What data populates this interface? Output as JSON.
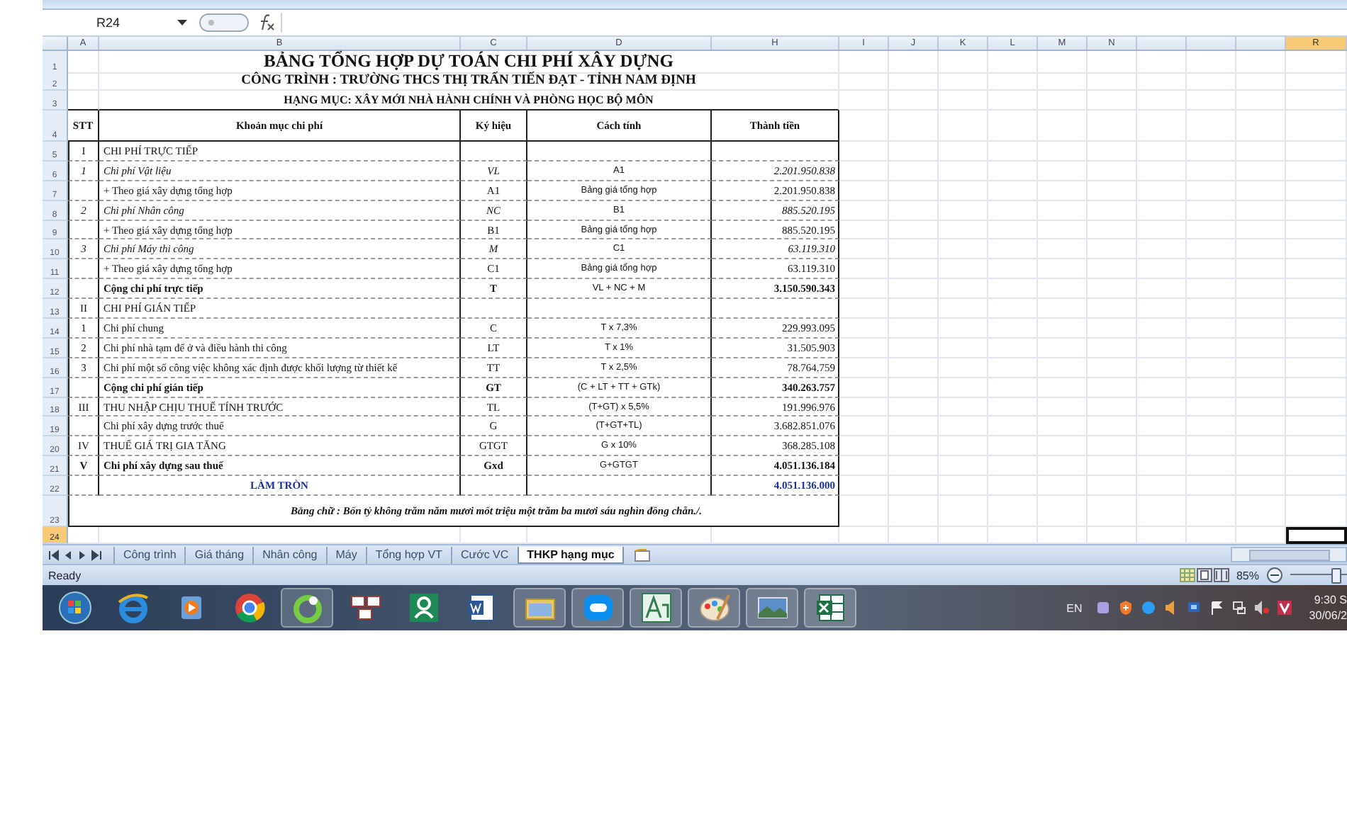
{
  "name_box": "R24",
  "column_headers": [
    {
      "label": "A",
      "selected": false
    },
    {
      "label": "B",
      "selected": false
    },
    {
      "label": "C",
      "selected": false
    },
    {
      "label": "D",
      "selected": false
    },
    {
      "label": "H",
      "selected": false
    },
    {
      "label": "I",
      "selected": false
    },
    {
      "label": "J",
      "selected": false
    },
    {
      "label": "K",
      "selected": false
    },
    {
      "label": "L",
      "selected": false
    },
    {
      "label": "M",
      "selected": false
    },
    {
      "label": "N",
      "selected": false
    },
    {
      "label": "R",
      "selected": true
    }
  ],
  "row_headers": [
    {
      "label": "1",
      "selected": false
    },
    {
      "label": "2",
      "selected": false
    },
    {
      "label": "3",
      "selected": false
    },
    {
      "label": "4",
      "selected": false
    },
    {
      "label": "5",
      "selected": false
    },
    {
      "label": "6",
      "selected": false
    },
    {
      "label": "7",
      "selected": false
    },
    {
      "label": "8",
      "selected": false
    },
    {
      "label": "9",
      "selected": false
    },
    {
      "label": "10",
      "selected": false
    },
    {
      "label": "11",
      "selected": false
    },
    {
      "label": "12",
      "selected": false
    },
    {
      "label": "13",
      "selected": false
    },
    {
      "label": "14",
      "selected": false
    },
    {
      "label": "15",
      "selected": false
    },
    {
      "label": "16",
      "selected": false
    },
    {
      "label": "17",
      "selected": false
    },
    {
      "label": "18",
      "selected": false
    },
    {
      "label": "19",
      "selected": false
    },
    {
      "label": "20",
      "selected": false
    },
    {
      "label": "21",
      "selected": false
    },
    {
      "label": "22",
      "selected": false
    },
    {
      "label": "23",
      "selected": false
    },
    {
      "label": "24",
      "selected": true
    }
  ],
  "titles": [
    "BẢNG TỔNG HỢP DỰ TOÁN CHI PHÍ XÂY DỰNG",
    "CÔNG TRÌNH : TRƯỜNG THCS THỊ TRẤN TIẾN ĐẠT - TỈNH NAM ĐỊNH",
    "HẠNG MỤC: XÂY MỚI NHÀ HÀNH CHÍNH VÀ PHÒNG HỌC BỘ MÔN"
  ],
  "table": {
    "columns": [
      "STT",
      "Khoản mục chi phí",
      "Ký hiệu",
      "Cách tính",
      "Thành tiền"
    ],
    "rows": [
      {
        "kind": "group",
        "stt": "I",
        "item": "CHI PHÍ TRỰC TIẾP"
      },
      {
        "kind": "italic",
        "stt": "1",
        "item": "Chi phí Vật liệu",
        "symbol": "VL",
        "formula": "A1",
        "amount": "2.201.950.838"
      },
      {
        "kind": "plain",
        "item": "+ Theo giá xây dựng tổng hợp",
        "symbol": "A1",
        "formula": "Bảng giá tổng hợp",
        "amount": "2.201.950.838"
      },
      {
        "kind": "italic",
        "stt": "2",
        "item": "Chi phí Nhân công",
        "symbol": "NC",
        "formula": "B1",
        "amount": "885.520.195"
      },
      {
        "kind": "plain",
        "item": "+ Theo giá xây dựng tổng hợp",
        "symbol": "B1",
        "formula": "Bảng giá tổng hợp",
        "amount": "885.520.195"
      },
      {
        "kind": "italic",
        "stt": "3",
        "item": "Chi phí Máy thi công",
        "symbol": "M",
        "formula": "C1",
        "amount": "63.119.310"
      },
      {
        "kind": "plain",
        "item": "+ Theo giá xây dựng tổng hợp",
        "symbol": "C1",
        "formula": "Bảng giá tổng hợp",
        "amount": "63.119.310"
      },
      {
        "kind": "total",
        "item": "Cộng chi phí trực tiếp",
        "symbol": "T",
        "formula": "VL + NC + M",
        "amount": "3.150.590.343"
      },
      {
        "kind": "group",
        "stt": "II",
        "item": "CHI PHÍ GIÁN TIẾP"
      },
      {
        "kind": "plain",
        "stt": "1",
        "item": "Chi phí chung",
        "symbol": "C",
        "formula": "T x 7,3%",
        "amount": "229.993.095"
      },
      {
        "kind": "plain",
        "stt": "2",
        "item": "Chi phí nhà tạm để ở và điều hành thi công",
        "symbol": "LT",
        "formula": "T x 1%",
        "amount": "31.505.903"
      },
      {
        "kind": "plain",
        "stt": "3",
        "item": "Chi phí một số công việc không xác định được khối lượng từ thiết kế",
        "symbol": "TT",
        "formula": "T x 2,5%",
        "amount": "78.764.759"
      },
      {
        "kind": "total",
        "item": "Cộng chi phí gián tiếp",
        "symbol": "GT",
        "formula": "(C + LT + TT + GTk)",
        "amount": "340.263.757"
      },
      {
        "kind": "group",
        "stt": "III",
        "item": "THU NHẬP CHỊU THUẾ TÍNH TRƯỚC",
        "symbol": "TL",
        "formula": "(T+GT) x 5,5%",
        "amount": "191.996.976"
      },
      {
        "kind": "plain",
        "item": "Chi phí xây dựng trước thuế",
        "symbol": "G",
        "formula": "(T+GT+TL)",
        "amount": "3.682.851.076"
      },
      {
        "kind": "group",
        "stt": "IV",
        "item": "THUẾ GIÁ TRỊ GIA TĂNG",
        "symbol": "GTGT",
        "formula": "G x 10%",
        "amount": "368.285.108"
      },
      {
        "kind": "total",
        "stt": "V",
        "item": "Chi phí xây dựng sau thuế",
        "symbol": "Gxd",
        "formula": "G+GTGT",
        "amount": "4.051.136.184"
      },
      {
        "kind": "rounding",
        "item": "LÀM TRÒN",
        "amount": "4.051.136.000"
      }
    ],
    "in_words": "Bằng chữ : Bốn tỷ không trăm năm mươi mốt triệu một trăm ba mươi sáu nghìn đồng chẵn./."
  },
  "sheet_tabs": [
    {
      "label": "Công trình",
      "selected": false
    },
    {
      "label": "Giá tháng",
      "selected": false
    },
    {
      "label": "Nhân công",
      "selected": false
    },
    {
      "label": "Máy",
      "selected": false
    },
    {
      "label": "Tổng hợp VT",
      "selected": false
    },
    {
      "label": "Cước VC",
      "selected": false
    },
    {
      "label": "THKP hạng mục",
      "selected": true
    }
  ],
  "status_bar": {
    "text": "Ready",
    "zoom": "85%",
    "zoom_slider": {
      "level": 0.8
    }
  },
  "taskbar": {
    "language": "EN",
    "time": "9:30 S",
    "date": "30/06/2"
  }
}
